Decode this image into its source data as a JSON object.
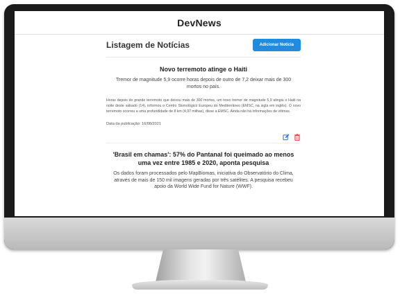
{
  "app": {
    "title": "DevNews"
  },
  "list": {
    "title": "Listagem de Notícias",
    "add_button_label": "Adicionar Notícia"
  },
  "news": [
    {
      "title": "Novo terremoto atinge o Haiti",
      "subtitle": "Tremor de magnitude 5,9 ocorre horas depois de outro de 7,2 deixar mais de 300 mortos no país.",
      "body": "Horas depois do grande terremoto que deixou mais de 300 mortos, um novo tremor de magnitude 5,9 atingiu o Haiti na noite deste sábado (14), informou o Centro Sismológico Europeu do Mediterrâneo (EMSC, na sigla em inglês). O novo terremoto ocorreu a uma profundidade de 8 km (4,97 milhas), disse a EMSC. Ainda não há informações de vítimas.",
      "date": "Data da publicação: 16/08/2021",
      "edit_icon": "edit-icon",
      "delete_icon": "trash-icon"
    },
    {
      "title": "'Brasil em chamas': 57% do Pantanal foi queimado ao menos uma vez entre 1985 e 2020, aponta pesquisa",
      "subtitle": "Os dados foram processados pelo MapBiomas, iniciativa do Observatório do Clima, através de mais de 150 mil imagens geradas por três satélites. A pesquisa recebeu apoio da World Wide Fund for Nature (WWF)."
    }
  ],
  "colors": {
    "accent": "#1f8ce0",
    "edit": "#2b6fd6",
    "delete": "#e53935"
  }
}
